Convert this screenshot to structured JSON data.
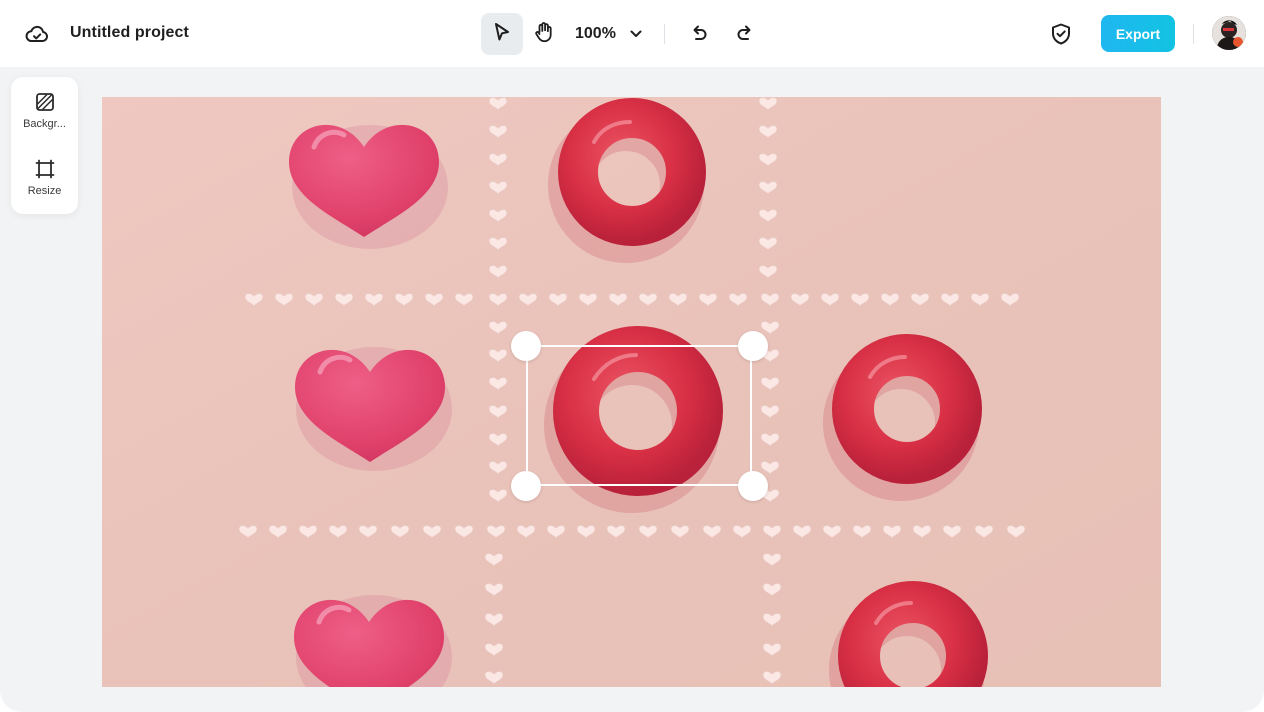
{
  "header": {
    "project_title": "Untitled project",
    "zoom_level": "100%",
    "export_label": "Export"
  },
  "sidebar": {
    "items": [
      {
        "label": "Backgr...",
        "icon": "background-icon"
      },
      {
        "label": "Resize",
        "icon": "resize-icon"
      }
    ]
  },
  "canvas": {
    "image_subject": "tic-tac-toe",
    "pieces": [
      {
        "cell": "top-left",
        "type": "heart"
      },
      {
        "cell": "top-center",
        "type": "ring"
      },
      {
        "cell": "middle-left",
        "type": "heart"
      },
      {
        "cell": "middle-center",
        "type": "ring",
        "selected": true
      },
      {
        "cell": "middle-right",
        "type": "ring"
      },
      {
        "cell": "bottom-left",
        "type": "heart"
      },
      {
        "cell": "bottom-right",
        "type": "ring"
      }
    ]
  },
  "colors": {
    "accent": "#1fb7f0",
    "canvas_bg": "#ecc5bc",
    "heart": "#e0416b",
    "ring": "#d93045"
  }
}
